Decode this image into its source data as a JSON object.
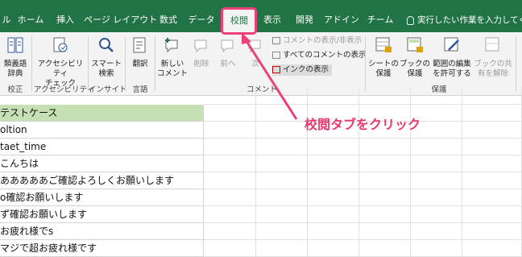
{
  "tabs": [
    {
      "label": "ル",
      "active": false
    },
    {
      "label": "ホーム",
      "active": false
    },
    {
      "label": "挿入",
      "active": false
    },
    {
      "label": "ページ レイアウト",
      "active": false
    },
    {
      "label": "数式",
      "active": false
    },
    {
      "label": "データ",
      "active": false
    },
    {
      "label": "校閲",
      "active": true
    },
    {
      "label": "表示",
      "active": false
    },
    {
      "label": "開発",
      "active": false
    },
    {
      "label": "アドイン",
      "active": false
    },
    {
      "label": "チーム",
      "active": false
    }
  ],
  "tell_me": "実行したい作業を入力してくださ",
  "ribbon": {
    "proofing": {
      "line1": "類義語",
      "line2": "辞典",
      "group": "校正"
    },
    "accessibility": {
      "line1": "アクセシビリティ",
      "line2": "チェック",
      "group": "アクセシビリティ"
    },
    "insights": {
      "line1": "スマート",
      "line2": "検索",
      "group": "インサイト"
    },
    "language": {
      "line1": "翻訳",
      "group": "言語"
    },
    "comments": {
      "new_line1": "新しい",
      "new_line2": "コメント",
      "delete": "削除",
      "prev": "前へ",
      "next": "次",
      "show_hide": "コメントの表示/非表示",
      "show_all": "すべてのコメントの表示",
      "show_ink": "インクの表示",
      "group": "コメント"
    },
    "protect": {
      "sheet_line1": "シートの",
      "sheet_line2": "保護",
      "book_line1": "ブックの",
      "book_line2": "保護",
      "allow_line1": "範囲の編集",
      "allow_line2": "を許可する",
      "share_line1": "ブックの共",
      "share_line2": "有を解除",
      "group": "保護"
    }
  },
  "cells": [
    "テストケース",
    "oltion",
    "taet_time",
    "こんちは",
    "あああああご確認よろしくお願いします",
    "o確認お願いします",
    "ず確認お願いします",
    "お疲れ様でs",
    "マジで超お疲れ様です"
  ],
  "annotation": "校閲タブをクリック",
  "colors": {
    "excel_green": "#217346",
    "header_fill": "#c6e0b4",
    "highlight_pink": "#ec407a",
    "annotation_pink": "#e8396b"
  }
}
